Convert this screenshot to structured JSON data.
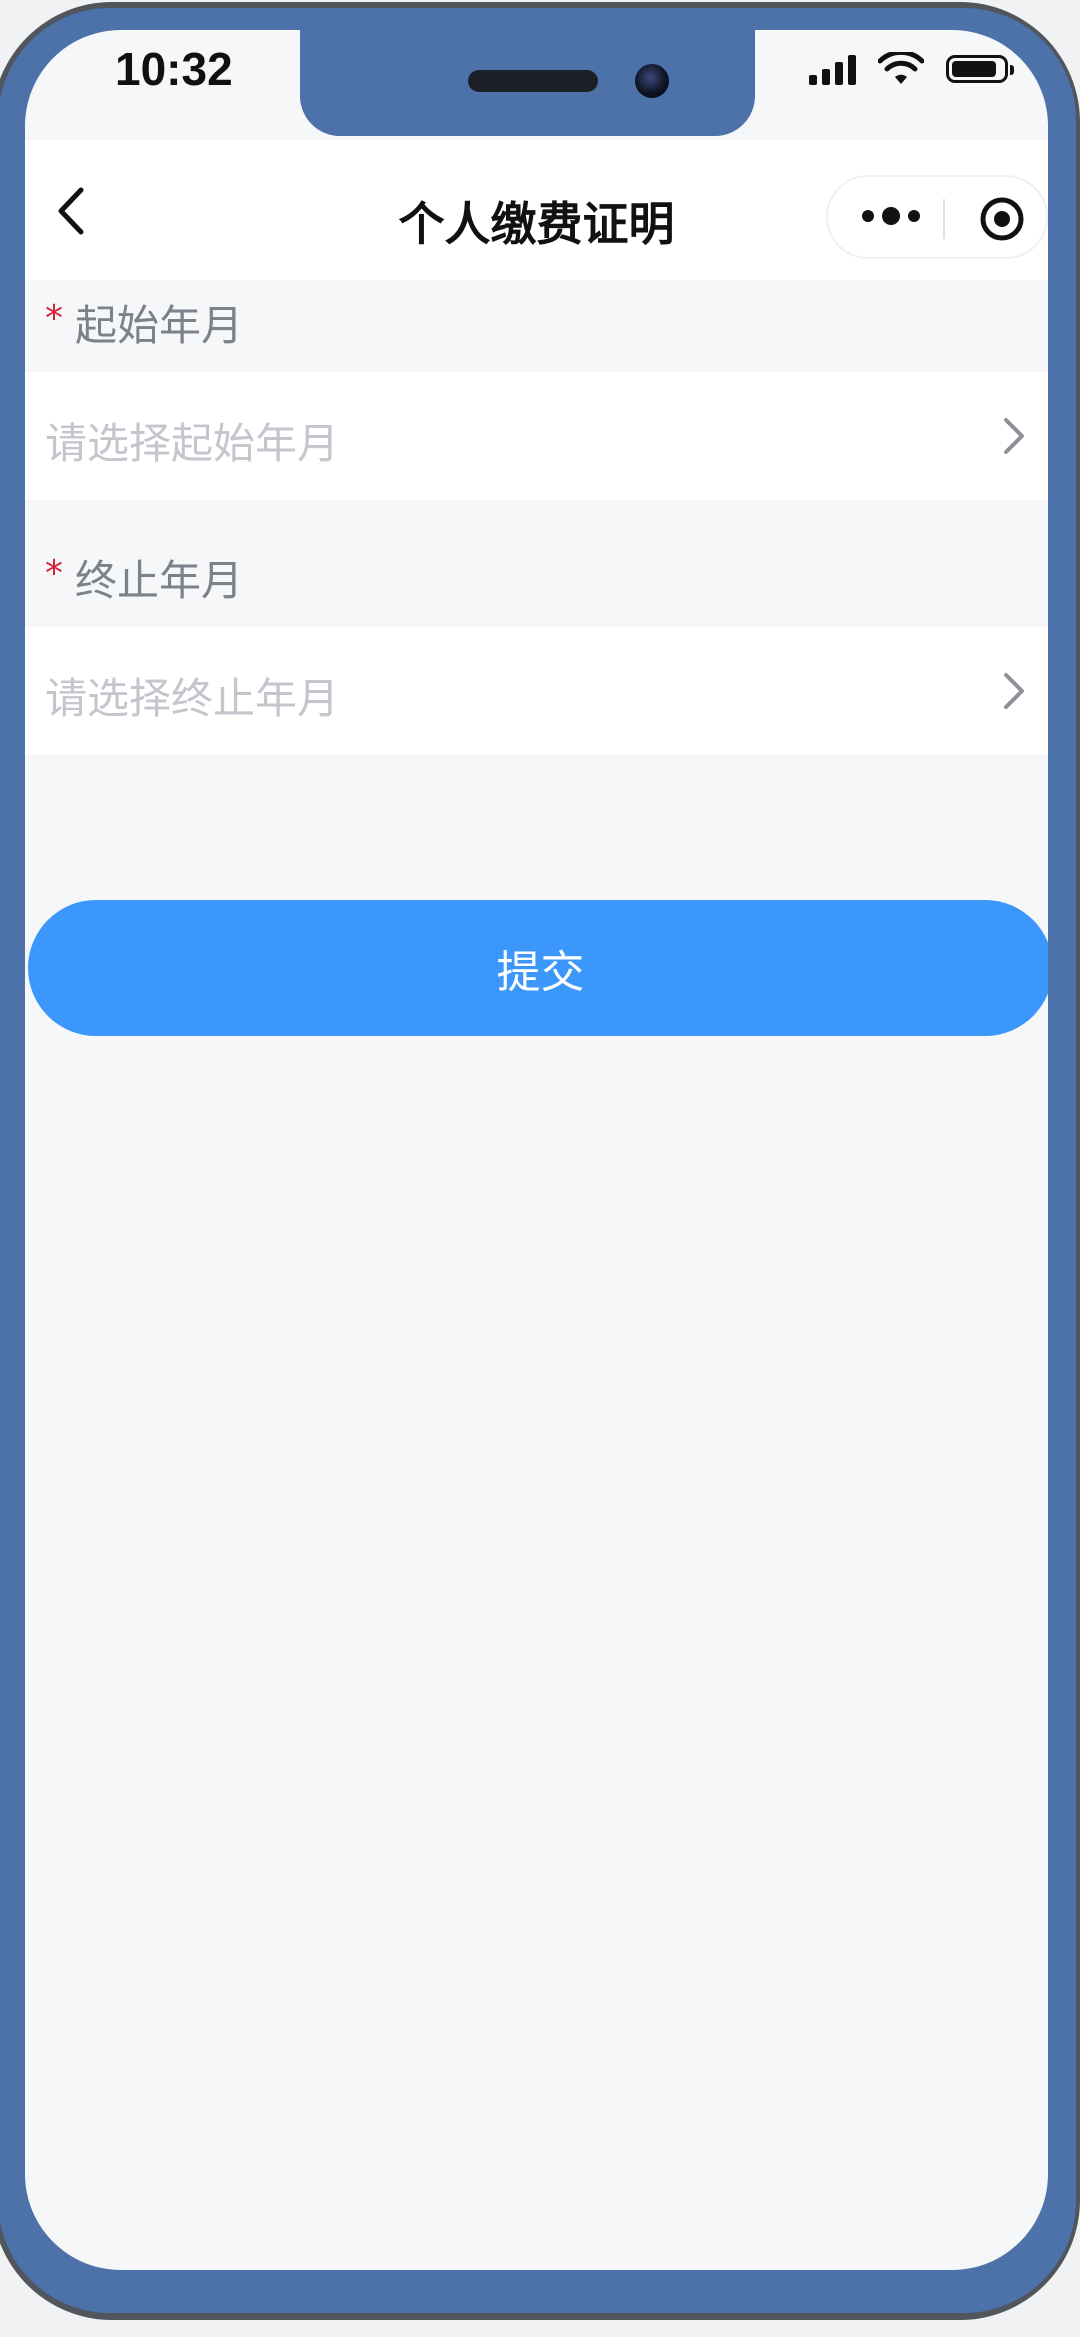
{
  "status_bar": {
    "time": "10:32"
  },
  "navbar": {
    "title": "个人缴费证明",
    "back_icon": "chevron-left-icon",
    "menu_icon": "more-dots-icon",
    "close_icon": "target-circle-icon"
  },
  "form": {
    "start": {
      "required_mark": "*",
      "label": "起始年月",
      "placeholder": "请选择起始年月"
    },
    "end": {
      "required_mark": "*",
      "label": "终止年月",
      "placeholder": "请选择终止年月"
    },
    "submit_label": "提交"
  },
  "colors": {
    "frame": "#4d71a9",
    "accent": "#3b97fa",
    "required": "#d6203a",
    "placeholder": "#c3c6cc",
    "label": "#7d8189",
    "background": "#f6f7f9"
  }
}
